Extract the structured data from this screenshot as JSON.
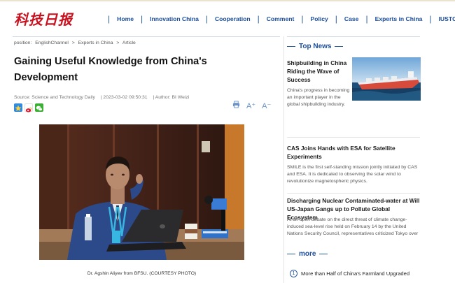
{
  "header": {
    "logo_text": "科技日报",
    "nav": [
      "Home",
      "Innovation China",
      "Cooperation",
      "Comment",
      "Policy",
      "Case",
      "Experts in China",
      "IUSTC"
    ]
  },
  "breadcrumb": {
    "label": "position:",
    "items": [
      "EnglishChannel",
      ">",
      "Experts in China",
      ">",
      "Article"
    ]
  },
  "article": {
    "title": "Gaining Useful Knowledge from China's Development",
    "source": "Source: Science and Technology Daily",
    "date": "| 2023-03-02 09:50:31",
    "author": "| Author: BI  Weizi",
    "photo_caption": "Dr. Agshin Aliyev  from  BFSU.  (COURTESY  PHOTO)"
  },
  "tools": {
    "print": "print",
    "font_up": "A⁺",
    "font_down": "A⁻"
  },
  "sidebar": {
    "top_news_label": "Top News",
    "news": [
      {
        "title": "Shipbuilding in China Riding the Wave of Success",
        "summary": "China's progress in becoming an important player in the global shipbuilding industry."
      },
      {
        "title": "CAS Joins Hands with ESA for Satellite Experiments",
        "summary": "SMILE is the first self-standing mission jointly initiated by CAS and ESA. It is dedicated to observing the solar wind to revolutionize magnetospheric physics."
      },
      {
        "title": "Discharging Nuclear Contaminated-water at Will US-Japan Gangs up to Pollute Global Ecosystem",
        "summary": "At an open debate on the direct threat of climate change-induced sea-level rise held on February 14 by the United Nations Security Council, representatives criticized Tokyo over"
      }
    ],
    "more_label": "more",
    "more_items": [
      {
        "num": "1",
        "title": "More than Half of China's Farmland Upgraded"
      }
    ]
  },
  "colors": {
    "logo": "#c8121f",
    "nav": "#1b4d9a"
  },
  "icons": [
    "qzone-icon",
    "weibo-icon",
    "wechat-icon",
    "print-icon",
    "font-increase-icon",
    "font-decrease-icon"
  ]
}
